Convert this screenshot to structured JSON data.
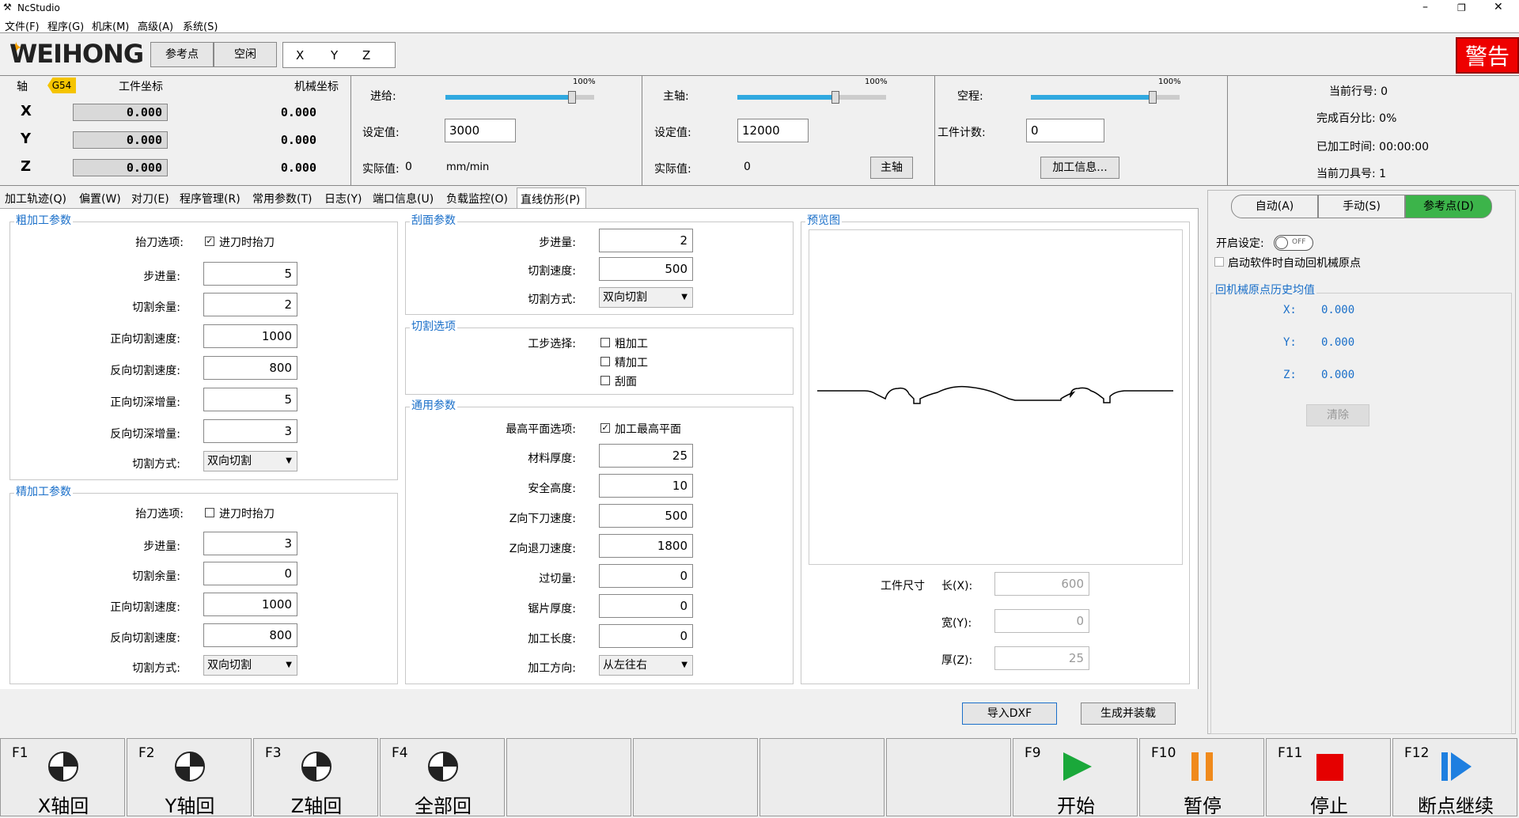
{
  "window": {
    "title": "NcStudio",
    "minimize": "–",
    "restore": "❐",
    "close": "✕"
  },
  "menu": [
    "文件(F)",
    "程序(G)",
    "机床(M)",
    "高级(A)",
    "系统(S)"
  ],
  "header": {
    "logo": "WEIHONG",
    "ref_button": "参考点",
    "idle_button": "空闲",
    "axes": [
      "X",
      "Y",
      "Z"
    ],
    "warning": "警告"
  },
  "coords": {
    "axis_label": "轴",
    "wcs": "G54",
    "work_label": "工件坐标",
    "machine_label": "机械坐标",
    "rows": [
      {
        "axis": "X",
        "work": "0.000",
        "machine": "0.000"
      },
      {
        "axis": "Y",
        "work": "0.000",
        "machine": "0.000"
      },
      {
        "axis": "Z",
        "work": "0.000",
        "machine": "0.000"
      }
    ]
  },
  "feed": {
    "label": "进给:",
    "pct": "100%",
    "level": 0.85,
    "set_label": "设定值:",
    "set_value": "3000",
    "actual_label": "实际值:",
    "actual_value": "0",
    "unit": "mm/min"
  },
  "spindle": {
    "label": "主轴:",
    "pct": "100%",
    "level": 0.66,
    "set_label": "设定值:",
    "set_value": "12000",
    "actual_label": "实际值:",
    "actual_value": "0",
    "button": "主轴"
  },
  "rapid": {
    "label": "空程:",
    "pct": "100%",
    "level": 0.82,
    "count_label": "工件计数:",
    "count_value": "0",
    "button": "加工信息..."
  },
  "status": {
    "line": "当前行号: 0",
    "percent": "完成百分比: 0%",
    "time": "已加工时间: 00:00:00",
    "tool": "当前刀具号: 1"
  },
  "tabs": [
    "加工轨迹(Q)",
    "偏置(W)",
    "对刀(E)",
    "程序管理(R)",
    "常用参数(T)",
    "日志(Y)",
    "端口信息(U)",
    "负载监控(O)",
    "直线仿形(P)"
  ],
  "rough": {
    "title": "粗加工参数",
    "lift_label": "抬刀选项:",
    "lift_check": "进刀时抬刀",
    "lift_checked": true,
    "rows": [
      {
        "label": "步进量:",
        "value": "5"
      },
      {
        "label": "切割余量:",
        "value": "2"
      },
      {
        "label": "正向切割速度:",
        "value": "1000"
      },
      {
        "label": "反向切割速度:",
        "value": "800"
      },
      {
        "label": "正向切深增量:",
        "value": "5"
      },
      {
        "label": "反向切深增量:",
        "value": "3"
      }
    ],
    "mode_label": "切割方式:",
    "mode_value": "双向切割"
  },
  "finish": {
    "title": "精加工参数",
    "lift_label": "抬刀选项:",
    "lift_check": "进刀时抬刀",
    "lift_checked": false,
    "rows": [
      {
        "label": "步进量:",
        "value": "3"
      },
      {
        "label": "切割余量:",
        "value": "0"
      },
      {
        "label": "正向切割速度:",
        "value": "1000"
      },
      {
        "label": "反向切割速度:",
        "value": "800"
      }
    ],
    "mode_label": "切割方式:",
    "mode_value": "双向切割"
  },
  "scrape": {
    "title": "刮面参数",
    "rows": [
      {
        "label": "步进量:",
        "value": "2"
      },
      {
        "label": "切割速度:",
        "value": "500"
      }
    ],
    "mode_label": "切割方式:",
    "mode_value": "双向切割"
  },
  "cutopts": {
    "title": "切割选项",
    "label": "工步选择:",
    "items": [
      "粗加工",
      "精加工",
      "刮面"
    ]
  },
  "general": {
    "title": "通用参数",
    "top_label": "最高平面选项:",
    "top_check": "加工最高平面",
    "top_checked": true,
    "rows": [
      {
        "label": "材料厚度:",
        "value": "25"
      },
      {
        "label": "安全高度:",
        "value": "10"
      },
      {
        "label": "Z向下刀速度:",
        "value": "500"
      },
      {
        "label": "Z向退刀速度:",
        "value": "1800"
      },
      {
        "label": "过切量:",
        "value": "0"
      },
      {
        "label": "锯片厚度:",
        "value": "0"
      },
      {
        "label": "加工长度:",
        "value": "0"
      }
    ],
    "dir_label": "加工方向:",
    "dir_value": "从左往右"
  },
  "preview": {
    "title": "预览图",
    "size_label": "工件尺寸",
    "len_label": "长(X):",
    "len_value": "600",
    "wid_label": "宽(Y):",
    "wid_value": "0",
    "thk_label": "厚(Z):",
    "thk_value": "25"
  },
  "actions": {
    "import": "导入DXF",
    "generate": "生成并装载"
  },
  "rightpanel": {
    "modes": [
      "自动(A)",
      "手动(S)",
      "参考点(D)"
    ],
    "startup_label": "开启设定:",
    "toggle": "OFF",
    "auto_home": "启动软件时自动回机械原点",
    "history_title": "回机械原点历史均值",
    "history": [
      {
        "axis": "X:",
        "value": "0.000"
      },
      {
        "axis": "Y:",
        "value": "0.000"
      },
      {
        "axis": "Z:",
        "value": "0.000"
      }
    ],
    "clear": "清除"
  },
  "fkeys": [
    {
      "key": "F1",
      "label": "X轴回",
      "icon": "home-target-icon"
    },
    {
      "key": "F2",
      "label": "Y轴回",
      "icon": "home-target-icon"
    },
    {
      "key": "F3",
      "label": "Z轴回",
      "icon": "home-target-icon"
    },
    {
      "key": "F4",
      "label": "全部回",
      "icon": "home-target-icon"
    },
    {
      "key": "",
      "label": "",
      "icon": ""
    },
    {
      "key": "",
      "label": "",
      "icon": ""
    },
    {
      "key": "",
      "label": "",
      "icon": ""
    },
    {
      "key": "",
      "label": "",
      "icon": ""
    },
    {
      "key": "F9",
      "label": "开始",
      "icon": "play-icon"
    },
    {
      "key": "F10",
      "label": "暂停",
      "icon": "pause-icon"
    },
    {
      "key": "F11",
      "label": "停止",
      "icon": "stop-icon"
    },
    {
      "key": "F12",
      "label": "断点继续",
      "icon": "resume-icon"
    }
  ],
  "colors": {
    "accent": "#30a9e0",
    "active_mode": "#3cb44a",
    "warning": "#ee0000",
    "play": "#1aa83a",
    "pause": "#f08a1c",
    "stop": "#e50000",
    "resume": "#1e7fe0"
  }
}
